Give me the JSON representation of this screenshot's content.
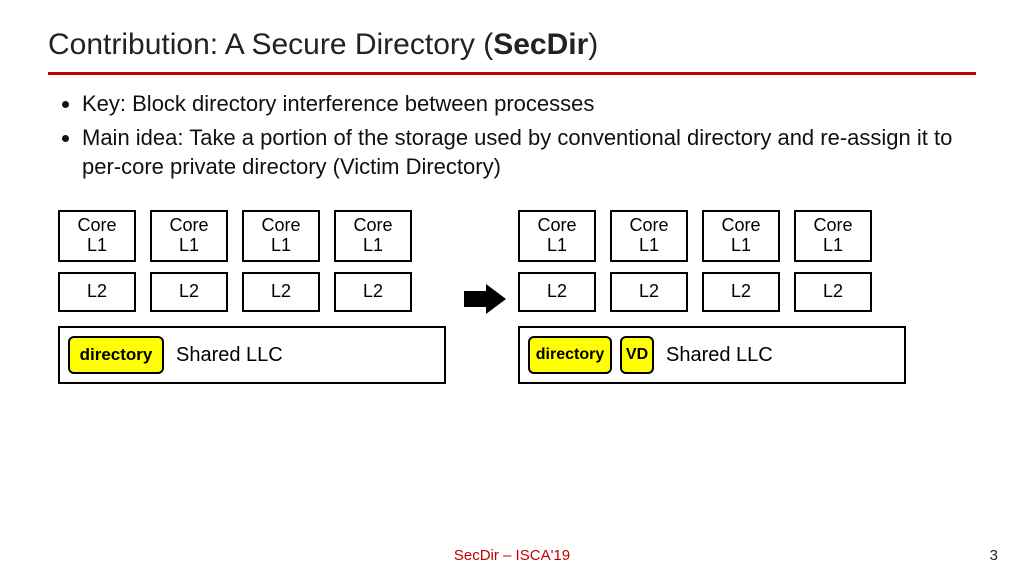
{
  "title_prefix": "Contribution: A Secure Directory (",
  "title_bold": "SecDir",
  "title_suffix": ")",
  "bullets": [
    "Key: Block directory interference between processes",
    "Main idea: Take a portion of the storage used by conventional directory and re-assign it to per-core private directory (Victim Directory)"
  ],
  "labels": {
    "core": "Core\nL1",
    "l2": "L2",
    "directory": "directory",
    "vd": "VD",
    "shared_llc": "Shared LLC"
  },
  "footer": "SecDir – ISCA'19",
  "page": "3"
}
